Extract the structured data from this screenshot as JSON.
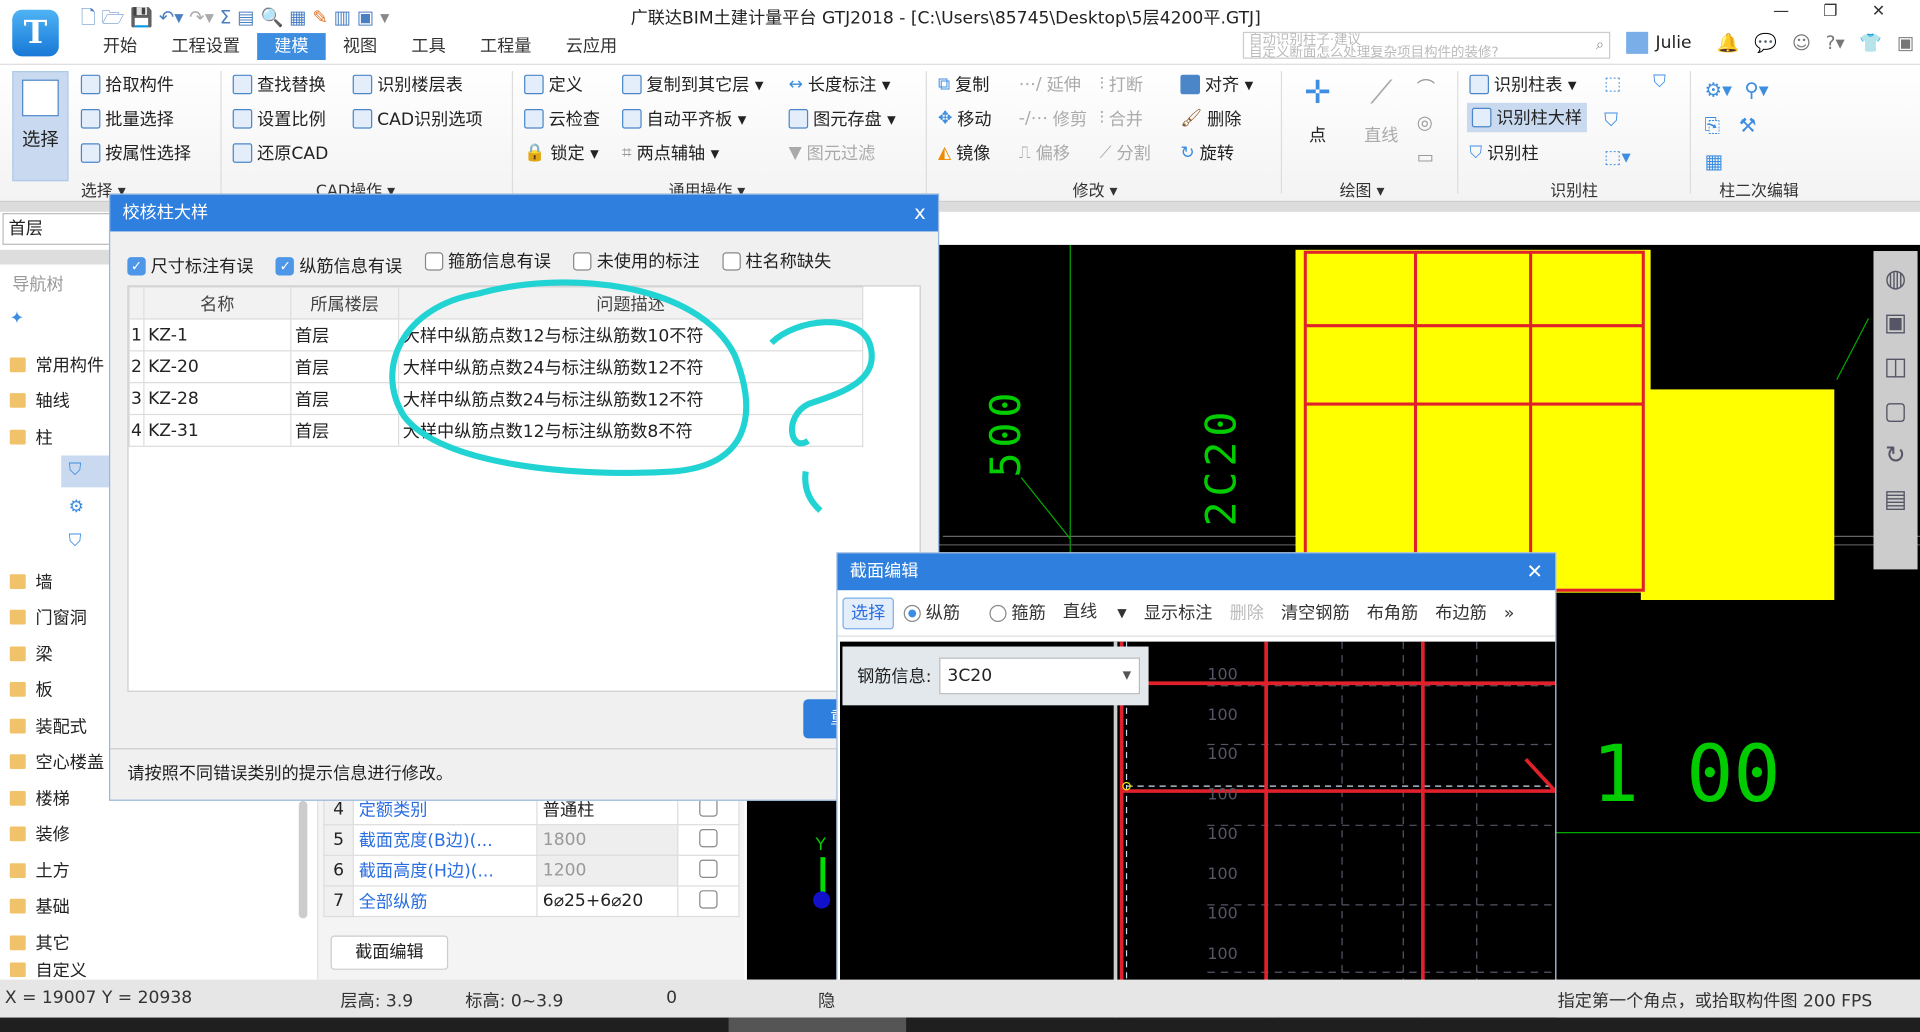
{
  "window": {
    "title": "广联达BIM土建计量平台 GTJ2018 - [C:\\Users\\85745\\Desktop\\5层4200平.GTJ]",
    "user": "Julie",
    "search_hint_1": "自动识别柱子·建议",
    "search_hint_2": "自定义断面怎么处理复杂项目构件的装修?",
    "logo_letter": "T",
    "controls": [
      "—",
      "❐",
      "✕"
    ]
  },
  "menu_tabs": [
    "开始",
    "工程设置",
    "建模",
    "视图",
    "工具",
    "工程量",
    "云应用"
  ],
  "active_tab": "建模",
  "ribbon": {
    "select": {
      "big": "选择",
      "items": [
        "拾取构件",
        "批量选择",
        "按属性选择"
      ],
      "group": "选择 ▾"
    },
    "cad": {
      "items": [
        "查找替换",
        "设置比例",
        "还原CAD",
        "识别楼层表",
        "CAD识别选项"
      ],
      "group": "CAD操作 ▾"
    },
    "common": {
      "items": [
        "定义",
        "云检查",
        "锁定 ▾",
        "复制到其它层 ▾",
        "自动平齐板 ▾",
        "两点辅轴 ▾",
        "长度标注 ▾",
        "图元存盘 ▾",
        "图元过滤"
      ],
      "group": "通用操作 ▾"
    },
    "modify": {
      "items": [
        "复制",
        "移动",
        "镜像",
        "延伸",
        "修剪",
        "偏移",
        "打断",
        "合并",
        "分割",
        "对齐 ▾",
        "删除",
        "旋转"
      ],
      "group": "修改 ▾"
    },
    "draw": {
      "items": [
        "点",
        "直线"
      ],
      "group": "绘图 ▾"
    },
    "recog": {
      "items": [
        "识别柱表 ▾",
        "识别柱大样",
        "识别柱"
      ],
      "group": "识别柱"
    },
    "second": {
      "group": "柱二次编辑"
    }
  },
  "floor_selector": "首层",
  "nav": {
    "title": "导航树",
    "items": [
      "常用构件",
      "轴线",
      "柱",
      "墙",
      "门窗洞",
      "梁",
      "板",
      "装配式",
      "空心楼盖",
      "楼梯",
      "装修",
      "土方",
      "基础",
      "其它",
      "自定义"
    ]
  },
  "check_dialog": {
    "title": "校核柱大样",
    "close": "x",
    "filters": [
      {
        "label": "尺寸标注有误",
        "checked": true
      },
      {
        "label": "纵筋信息有误",
        "checked": true
      },
      {
        "label": "箍筋信息有误",
        "checked": false
      },
      {
        "label": "未使用的标注",
        "checked": false
      },
      {
        "label": "柱名称缺失",
        "checked": false
      }
    ],
    "columns": [
      "名称",
      "所属楼层",
      "问题描述"
    ],
    "rows": [
      {
        "n": "1",
        "name": "KZ-1",
        "floor": "首层",
        "desc": "大样中纵筋点数12与标注纵筋数10不符"
      },
      {
        "n": "2",
        "name": "KZ-20",
        "floor": "首层",
        "desc": "大样中纵筋点数24与标注纵筋数12不符"
      },
      {
        "n": "3",
        "name": "KZ-28",
        "floor": "首层",
        "desc": "大样中纵筋点数24与标注纵筋数12不符"
      },
      {
        "n": "4",
        "name": "KZ-31",
        "floor": "首层",
        "desc": "大样中纵筋点数12与标注纵筋数8不符"
      }
    ],
    "hint": "请按照不同错误类别的提示信息进行修改。",
    "btn": "重"
  },
  "props": {
    "rows": [
      {
        "n": "4",
        "name": "定额类别",
        "val": "普通柱"
      },
      {
        "n": "5",
        "name": "截面宽度(B边)(...",
        "val": "1800"
      },
      {
        "n": "6",
        "name": "截面高度(H边)(...",
        "val": "1200"
      },
      {
        "n": "7",
        "name": "全部纵筋",
        "val": "6⌀25+6⌀20"
      }
    ],
    "edit_btn": "截面编辑"
  },
  "section_dialog": {
    "title": "截面编辑",
    "close": "✕",
    "tools": [
      "选择",
      "纵筋",
      "箍筋",
      "直线",
      "显示标注",
      "删除",
      "清空钢筋",
      "布角筋",
      "布边筋",
      "»"
    ],
    "rebar_label": "钢筋信息:",
    "rebar_value": "3C20",
    "dims": [
      "100",
      "100",
      "100",
      "100",
      "100",
      "100",
      "100",
      "100",
      "100",
      "100",
      "100"
    ]
  },
  "cad_text": {
    "a": "500",
    "b": "2C20",
    "c": "1 00",
    "axis_y": "Y"
  },
  "status": {
    "coords": "X = 19007 Y = 20938",
    "floor_h": "层高:  3.9",
    "elev": "标高:  0~3.9",
    "zero": "0",
    "hide": "隐",
    "prompt": "指定第一个角点，或拾取构件图 200 FPS"
  },
  "colors": {
    "accent": "#2f7fde",
    "cad_yellow": "#ffff00",
    "rebar_red": "#e0202a",
    "annotation": "#22d3d3"
  }
}
